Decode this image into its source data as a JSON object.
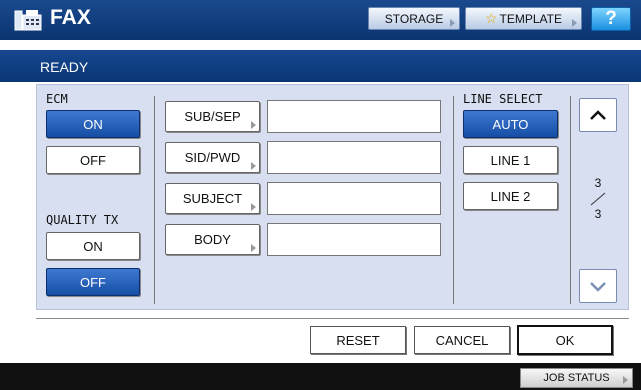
{
  "header": {
    "title": "FAX",
    "storage_label": "STORAGE",
    "template_label": "TEMPLATE",
    "help_label": "?"
  },
  "status": {
    "text": "READY"
  },
  "ecm": {
    "label": "ECM",
    "on_label": "ON",
    "off_label": "OFF",
    "selected": "ON"
  },
  "quality_tx": {
    "label": "QUALITY TX",
    "on_label": "ON",
    "off_label": "OFF",
    "selected": "OFF"
  },
  "fields": [
    {
      "label": "SUB/SEP",
      "value": ""
    },
    {
      "label": "SID/PWD",
      "value": ""
    },
    {
      "label": "SUBJECT",
      "value": ""
    },
    {
      "label": "BODY",
      "value": ""
    }
  ],
  "line_select": {
    "label": "LINE SELECT",
    "options": [
      "AUTO",
      "LINE 1",
      "LINE 2"
    ],
    "selected": "AUTO"
  },
  "pager": {
    "current": "3",
    "total": "3"
  },
  "actions": {
    "reset_label": "RESET",
    "cancel_label": "CANCEL",
    "ok_label": "OK"
  },
  "footer": {
    "job_status_label": "JOB STATUS"
  },
  "colors": {
    "header_blue": "#0c3a7a",
    "selected_blue": "#1e58b4",
    "panel_bg": "#d8dff0"
  },
  "icons": [
    "fax-icon",
    "star-icon",
    "chevron-up-icon",
    "chevron-down-icon"
  ]
}
